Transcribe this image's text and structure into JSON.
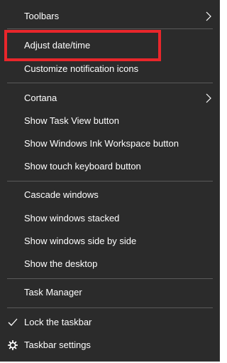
{
  "menu": {
    "items": [
      {
        "label": "Toolbars"
      },
      {
        "label": "Adjust date/time"
      },
      {
        "label": "Customize notification icons"
      },
      {
        "label": "Cortana"
      },
      {
        "label": "Show Task View button"
      },
      {
        "label": "Show Windows Ink Workspace button"
      },
      {
        "label": "Show touch keyboard button"
      },
      {
        "label": "Cascade windows"
      },
      {
        "label": "Show windows stacked"
      },
      {
        "label": "Show windows side by side"
      },
      {
        "label": "Show the desktop"
      },
      {
        "label": "Task Manager"
      },
      {
        "label": "Lock the taskbar"
      },
      {
        "label": "Taskbar settings"
      }
    ],
    "checked_item": "Lock the taskbar",
    "highlighted_item": "Adjust date/time"
  },
  "icons": {
    "submenu_arrow": "chevron-right-icon",
    "check": "checkmark-icon",
    "settings": "gear-icon"
  },
  "colors": {
    "menu_background": "#2b2b2b",
    "text": "#ffffff",
    "separator": "#5a5a5a",
    "highlight_border": "#e8262b"
  }
}
